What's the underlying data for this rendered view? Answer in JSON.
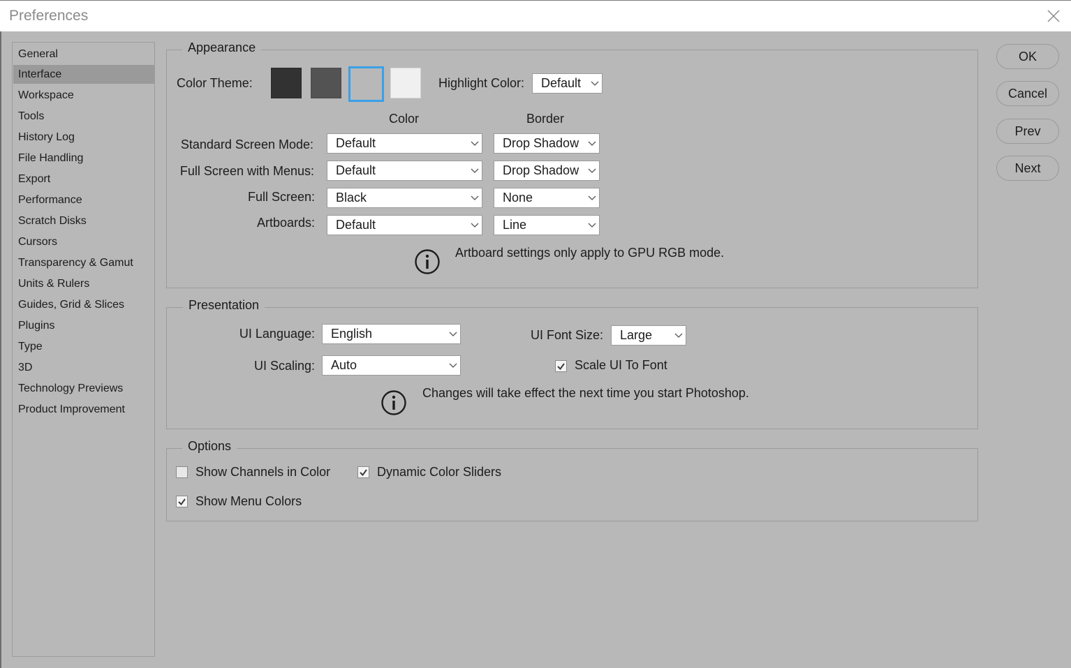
{
  "window": {
    "title": "Preferences"
  },
  "sidebar": {
    "items": [
      {
        "label": "General"
      },
      {
        "label": "Interface",
        "selected": true
      },
      {
        "label": "Workspace"
      },
      {
        "label": "Tools"
      },
      {
        "label": "History Log"
      },
      {
        "label": "File Handling"
      },
      {
        "label": "Export"
      },
      {
        "label": "Performance"
      },
      {
        "label": "Scratch Disks"
      },
      {
        "label": "Cursors"
      },
      {
        "label": "Transparency & Gamut"
      },
      {
        "label": "Units & Rulers"
      },
      {
        "label": "Guides, Grid & Slices"
      },
      {
        "label": "Plugins"
      },
      {
        "label": "Type"
      },
      {
        "label": "3D"
      },
      {
        "label": "Technology Previews"
      },
      {
        "label": "Product Improvement"
      }
    ]
  },
  "appearance": {
    "title": "Appearance",
    "color_theme_label": "Color Theme:",
    "themes": [
      {
        "name": "darkest",
        "color": "#323232"
      },
      {
        "name": "dark",
        "color": "#535353"
      },
      {
        "name": "medium",
        "color": "#b8b8b8",
        "selected": true
      },
      {
        "name": "light",
        "color": "#f0f0f0"
      }
    ],
    "highlight_label": "Highlight Color:",
    "highlight_value": "Default",
    "col_color": "Color",
    "col_border": "Border",
    "rows": [
      {
        "label": "Standard Screen Mode:",
        "color": "Default",
        "border": "Drop Shadow"
      },
      {
        "label": "Full Screen with Menus:",
        "color": "Default",
        "border": "Drop Shadow"
      },
      {
        "label": "Full Screen:",
        "color": "Black",
        "border": "None"
      },
      {
        "label": "Artboards:",
        "color": "Default",
        "border": "Line"
      }
    ],
    "note": "Artboard settings only apply to GPU RGB mode."
  },
  "presentation": {
    "title": "Presentation",
    "language_label": "UI Language:",
    "language_value": "English",
    "font_size_label": "UI Font Size:",
    "font_size_value": "Large",
    "scaling_label": "UI Scaling:",
    "scaling_value": "Auto",
    "scale_to_font_label": "Scale UI To Font",
    "scale_to_font_checked": true,
    "note": "Changes will take effect the next time you start Photoshop."
  },
  "options": {
    "title": "Options",
    "show_channels_label": "Show Channels in Color",
    "show_channels_checked": false,
    "dynamic_sliders_label": "Dynamic Color Sliders",
    "dynamic_sliders_checked": true,
    "show_menu_colors_label": "Show Menu Colors",
    "show_menu_colors_checked": true
  },
  "buttons": {
    "ok": "OK",
    "cancel": "Cancel",
    "prev": "Prev",
    "next": "Next"
  },
  "colors": {
    "background": "#b8b8b8",
    "selected_item": "#9a9a9a",
    "selected_theme_border": "#3aa0e8"
  }
}
